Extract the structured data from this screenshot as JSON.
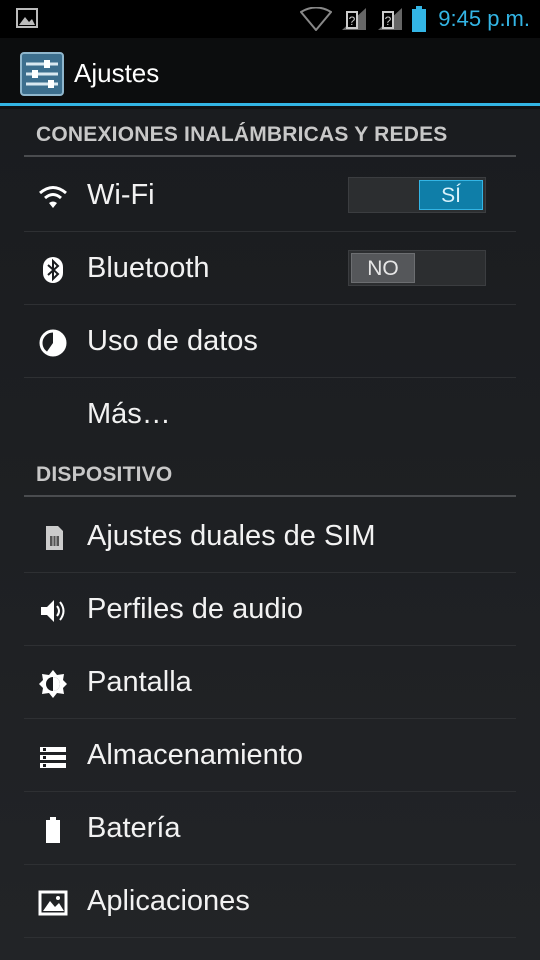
{
  "status_bar": {
    "time": "9:45 p.m.",
    "icons": [
      "gallery-notification-icon",
      "wifi-signal-icon",
      "sim1-signal-icon",
      "sim2-signal-icon",
      "battery-icon"
    ]
  },
  "action_bar": {
    "title": "Ajustes",
    "icon": "settings-sliders-icon"
  },
  "sections": [
    {
      "header": "CONEXIONES INALÁMBRICAS Y REDES",
      "items": [
        {
          "label": "Wi-Fi",
          "icon": "wifi-icon",
          "toggle": "SÍ",
          "toggle_state": "on"
        },
        {
          "label": "Bluetooth",
          "icon": "bluetooth-icon",
          "toggle": "NO",
          "toggle_state": "off"
        },
        {
          "label": "Uso de datos",
          "icon": "data-usage-icon"
        },
        {
          "label": "Más…"
        }
      ]
    },
    {
      "header": "DISPOSITIVO",
      "items": [
        {
          "label": "Ajustes duales de SIM",
          "icon": "sim-card-icon"
        },
        {
          "label": "Perfiles de audio",
          "icon": "speaker-icon"
        },
        {
          "label": "Pantalla",
          "icon": "brightness-icon"
        },
        {
          "label": "Almacenamiento",
          "icon": "storage-icon"
        },
        {
          "label": "Batería",
          "icon": "battery-icon"
        },
        {
          "label": "Aplicaciones",
          "icon": "apps-image-icon"
        }
      ]
    }
  ],
  "colors": {
    "accent": "#33b5e5",
    "background": "#1a1c1f",
    "header_text": "#c8c8c8"
  }
}
